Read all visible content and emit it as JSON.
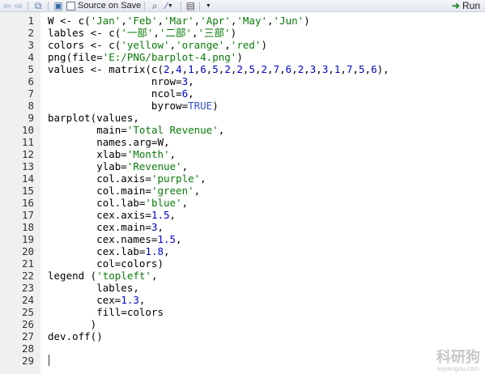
{
  "toolbar": {
    "back_icon": "arrow-left-icon",
    "forward_icon": "arrow-right-icon",
    "show_in_window_icon": "popout-icon",
    "save_icon": "floppy-disk-icon",
    "source_on_save_label": "Source on Save",
    "search_icon": "magnifier-icon",
    "wand_icon": "magic-wand-icon",
    "compile_icon": "notebook-icon",
    "run_label": "Run"
  },
  "code_lines": [
    {
      "n": "1"
    },
    {
      "n": "2"
    },
    {
      "n": "3"
    },
    {
      "n": "4"
    },
    {
      "n": "5"
    },
    {
      "n": "6"
    },
    {
      "n": "7"
    },
    {
      "n": "8"
    },
    {
      "n": "9"
    },
    {
      "n": "10"
    },
    {
      "n": "11"
    },
    {
      "n": "12"
    },
    {
      "n": "13"
    },
    {
      "n": "14"
    },
    {
      "n": "15"
    },
    {
      "n": "16"
    },
    {
      "n": "17"
    },
    {
      "n": "18"
    },
    {
      "n": "19"
    },
    {
      "n": "20"
    },
    {
      "n": "21"
    },
    {
      "n": "22"
    },
    {
      "n": "23"
    },
    {
      "n": "24"
    },
    {
      "n": "25"
    },
    {
      "n": "26"
    },
    {
      "n": "27"
    },
    {
      "n": "28"
    },
    {
      "n": "29"
    }
  ],
  "code": {
    "l1": [
      "W <- c(",
      "'Jan'",
      ",",
      "'Feb'",
      ",",
      "'Mar'",
      ",",
      "'Apr'",
      ",",
      "'May'",
      ",",
      "'Jun'",
      ")"
    ],
    "l2": [
      "lables <- c(",
      "'一部'",
      ",",
      "'二部'",
      ",",
      "'三部'",
      ")"
    ],
    "l3": [
      "colors <- c(",
      "'yellow'",
      ",",
      "'orange'",
      ",",
      "'red'",
      ")"
    ],
    "l4": [
      "png(file=",
      "'E:/PNG/barplot-4.png'",
      ")"
    ],
    "l5": [
      "values <- matrix(c(",
      "2",
      ",",
      "4",
      ",",
      "1",
      ",",
      "6",
      ",",
      "5",
      ",",
      "2",
      ",",
      "2",
      ",",
      "5",
      ",",
      "2",
      ",",
      "7",
      ",",
      "6",
      ",",
      "2",
      ",",
      "3",
      ",",
      "3",
      ",",
      "1",
      ",",
      "7",
      ",",
      "5",
      ",",
      "6",
      "),"
    ],
    "l6": [
      "                 nrow=",
      "3",
      ","
    ],
    "l7": [
      "                 ncol=",
      "6",
      ","
    ],
    "l8": [
      "                 byrow=",
      "TRUE",
      ")"
    ],
    "l9": [
      "barplot(values,"
    ],
    "l10": [
      "        main=",
      "'Total Revenue'",
      ","
    ],
    "l11": [
      "        names.arg=W,"
    ],
    "l12": [
      "        xlab=",
      "'Month'",
      ","
    ],
    "l13": [
      "        ylab=",
      "'Revenue'",
      ","
    ],
    "l14": [
      "        col.axis=",
      "'purple'",
      ","
    ],
    "l15": [
      "        col.main=",
      "'green'",
      ","
    ],
    "l16": [
      "        col.lab=",
      "'blue'",
      ","
    ],
    "l17": [
      "        cex.axis=",
      "1.5",
      ","
    ],
    "l18": [
      "        cex.main=",
      "3",
      ","
    ],
    "l19": [
      "        cex.names=",
      "1.5",
      ","
    ],
    "l20": [
      "        cex.lab=",
      "1.8",
      ","
    ],
    "l21": [
      "        col=colors)"
    ],
    "l22": [
      "legend (",
      "'topleft'",
      ","
    ],
    "l23": [
      "        lables,"
    ],
    "l24": [
      "        cex=",
      "1.3",
      ","
    ],
    "l25": [
      "        fill=colors"
    ],
    "l26": [
      "       )"
    ],
    "l27": [
      "dev.off()"
    ]
  },
  "watermark": {
    "main": "科研狗",
    "sub": "keyangou.com"
  }
}
